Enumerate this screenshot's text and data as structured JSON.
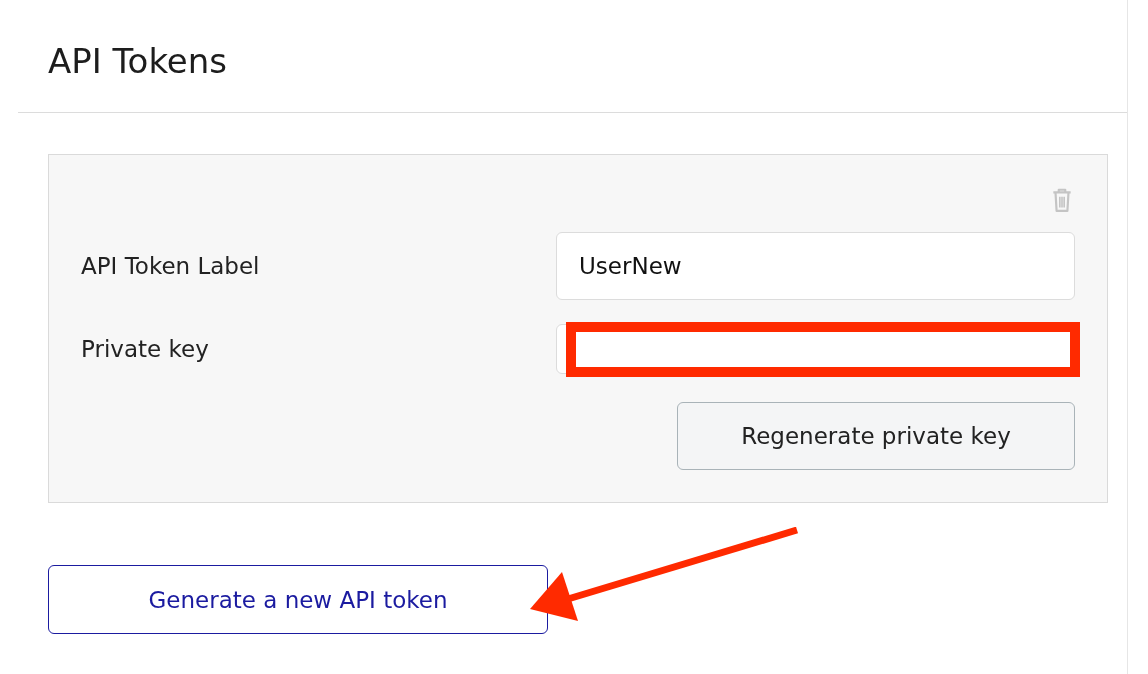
{
  "page": {
    "title": "API Tokens"
  },
  "token_card": {
    "fields": [
      {
        "label": "API Token Label",
        "value": "UserNew",
        "highlighted": false
      },
      {
        "label": "Private key",
        "highlighted": true
      }
    ],
    "regenerate_button": "Regenerate private key"
  },
  "generate_button": {
    "label": "Generate a new API token",
    "pointed_at": true
  }
}
